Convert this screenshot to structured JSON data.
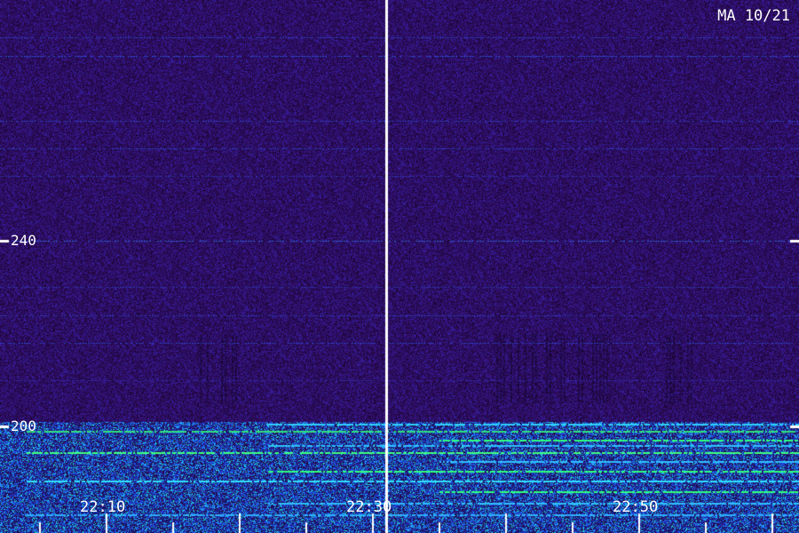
{
  "chart_data": {
    "type": "heatmap",
    "title": "MA 10/21",
    "y_ticks": [
      {
        "value": 240,
        "label": "240"
      },
      {
        "value": 200,
        "label": "200"
      }
    ],
    "ylim": [
      177,
      292
    ],
    "x_ticks": [
      {
        "value": "22:10",
        "label": "22:10"
      },
      {
        "value": "22:30",
        "label": "22:30"
      },
      {
        "value": "22:50",
        "label": "22:50"
      }
    ],
    "xlim": [
      "22:02",
      "23:02"
    ],
    "minor_tick_interval_minutes": 5,
    "cursor_time": "22:31",
    "colormap": [
      "#2a0a52",
      "#3a1aa0",
      "#3060ff",
      "#20c0ff",
      "#30ff80"
    ],
    "background_color": "#2a0a52",
    "signal_band": {
      "from": 177,
      "to": 201
    },
    "horizontal_lines": [
      {
        "y": 284,
        "color": "#3050e0"
      },
      {
        "y": 280,
        "color": "#2a6aff"
      },
      {
        "y": 266,
        "color": "#3050e0"
      },
      {
        "y": 260,
        "color": "#3050e0"
      },
      {
        "y": 254,
        "color": "#3040c0"
      },
      {
        "y": 240,
        "color": "#3080ff"
      },
      {
        "y": 230,
        "color": "#3040c0"
      },
      {
        "y": 224,
        "color": "#3048d0"
      },
      {
        "y": 218,
        "color": "#3050e0"
      },
      {
        "y": 210,
        "color": "#3a30c0"
      }
    ],
    "bright_lines": [
      {
        "y": 200.5,
        "color": "#30d0ff"
      },
      {
        "y": 199.0,
        "color": "#30e080"
      },
      {
        "y": 197.2,
        "color": "#30ff80"
      },
      {
        "y": 196.0,
        "color": "#30c0ff"
      },
      {
        "y": 194.5,
        "color": "#40ff80"
      },
      {
        "y": 192.6,
        "color": "#30c0ff"
      },
      {
        "y": 190.5,
        "color": "#30ff80"
      },
      {
        "y": 188.3,
        "color": "#30e0ff"
      },
      {
        "y": 186.0,
        "color": "#30ff80"
      },
      {
        "y": 183.5,
        "color": "#30c0ff"
      },
      {
        "y": 181.0,
        "color": "#30b0ff"
      }
    ]
  }
}
